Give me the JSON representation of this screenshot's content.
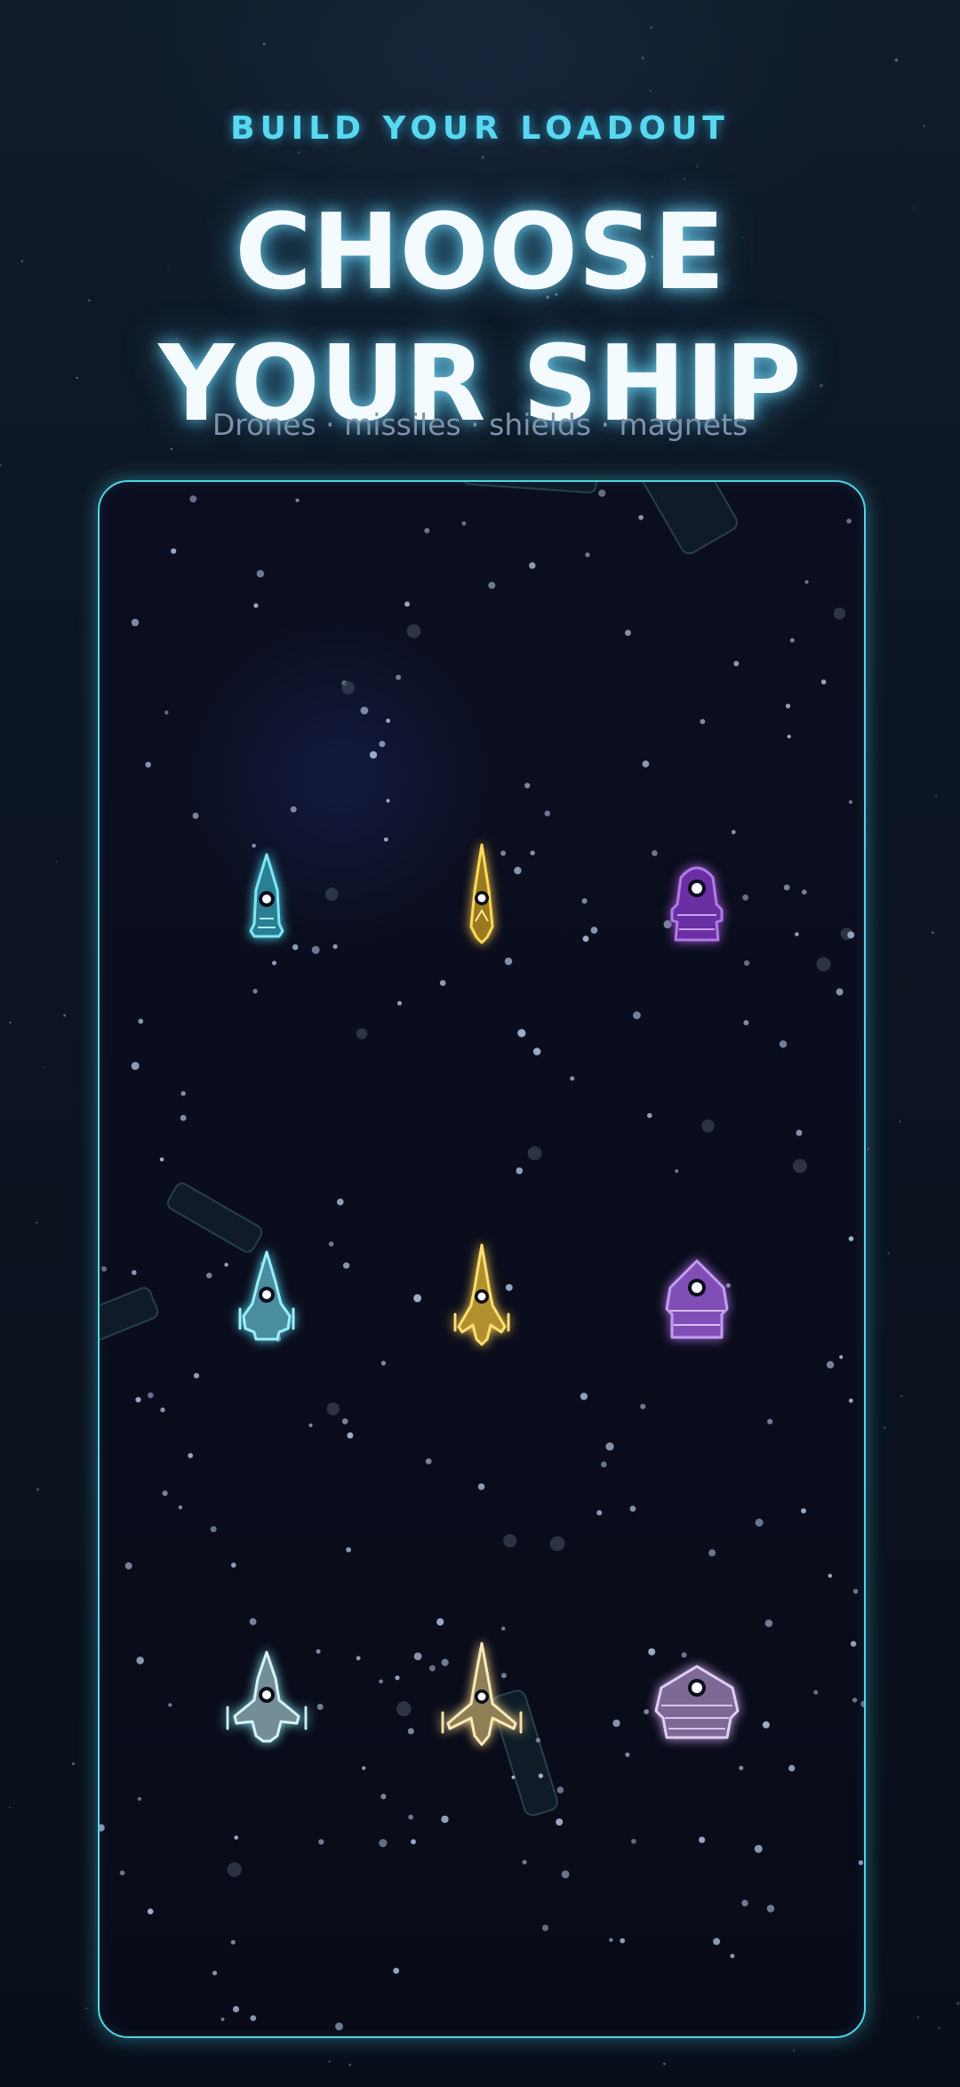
{
  "header": {
    "eyebrow": "BUILD YOUR LOADOUT",
    "title_line1": "CHOOSE",
    "title_line2": "YOUR SHIP",
    "subtitle": "Drones · missiles · shields · magnets"
  },
  "colors": {
    "accent_cyan": "#52d4e6",
    "ship_cyan": "#5fd6ea",
    "ship_gold": "#f2c64a",
    "ship_violet": "#9b5ad6",
    "ship_pale": "#cfe9f0",
    "ship_cream": "#f1dfab",
    "ship_lilac": "#c4a6e3"
  },
  "ships": [
    {
      "name": "ship-cyan-tier-1",
      "family": "interceptor",
      "tier": 1
    },
    {
      "name": "ship-gold-tier-1",
      "family": "striker",
      "tier": 1
    },
    {
      "name": "ship-violet-tier-1",
      "family": "tank",
      "tier": 1
    },
    {
      "name": "ship-cyan-tier-2",
      "family": "interceptor",
      "tier": 2
    },
    {
      "name": "ship-gold-tier-2",
      "family": "striker",
      "tier": 2
    },
    {
      "name": "ship-violet-tier-2",
      "family": "tank",
      "tier": 2
    },
    {
      "name": "ship-cyan-tier-3",
      "family": "interceptor",
      "tier": 3
    },
    {
      "name": "ship-gold-tier-3",
      "family": "striker",
      "tier": 3
    },
    {
      "name": "ship-violet-tier-3",
      "family": "tank",
      "tier": 3
    }
  ]
}
